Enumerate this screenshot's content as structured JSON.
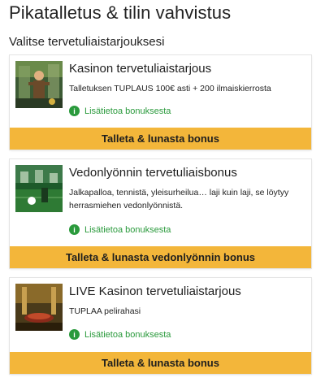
{
  "page": {
    "title": "Pikatalletus & tilin vahvistus",
    "subtitle": "Valitse tervetuliaistarjouksesi"
  },
  "offers": [
    {
      "title": "Kasinon tervetuliaistarjous",
      "description": "Talletuksen TUPLAUS 100€ asti + 200 ilmaiskierrosta",
      "info_link": "Lisätietoa bonuksesta",
      "cta": "Talleta & lunasta bonus",
      "thumbnail_icon": "casino-welcome-image"
    },
    {
      "title": "Vedonlyönnin tervetuliaisbonus",
      "description": "Jalkapalloa, tennistä, yleisurheilua… laji kuin laji, se löytyy herrasmiehen vedonlyönnistä.",
      "info_link": "Lisätietoa bonuksesta",
      "cta": "Talleta & lunasta vedonlyönnin bonus",
      "thumbnail_icon": "sportsbook-welcome-image"
    },
    {
      "title": "LIVE Kasinon tervetuliaistarjous",
      "description": "TUPLAA pelirahasi",
      "info_link": "Lisätietoa bonuksesta",
      "cta": "Talleta & lunasta bonus",
      "thumbnail_icon": "live-casino-welcome-image"
    }
  ],
  "colors": {
    "cta_background": "#f3b63a",
    "info_link": "#2a9a3c"
  }
}
